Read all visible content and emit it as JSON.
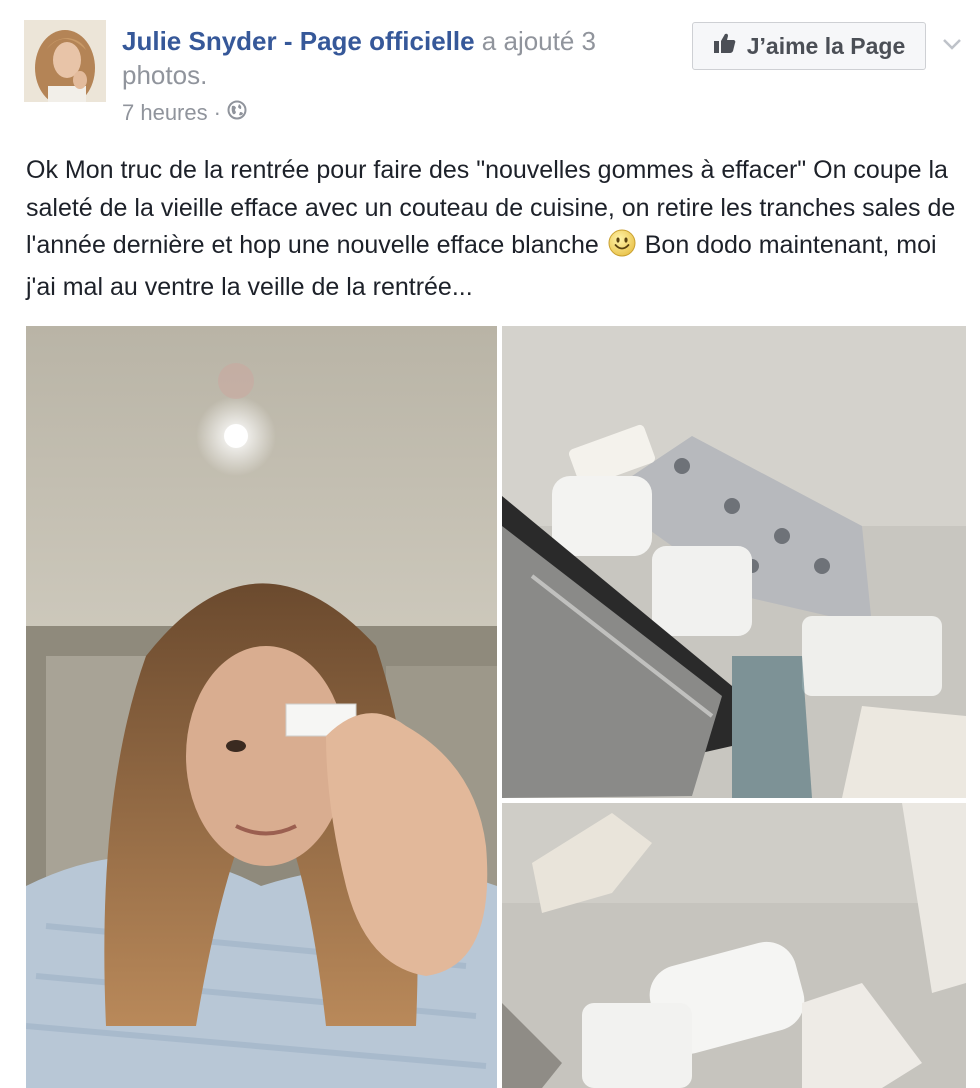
{
  "post": {
    "author": "Julie Snyder - Page officielle",
    "action": "a ajouté 3 photos.",
    "timestamp": "7 heures",
    "separator": "·",
    "privacy_icon": "globe-icon",
    "like_page_button": {
      "label": "J’aime la Page",
      "icon": "thumbs-up-icon"
    },
    "options_icon": "chevron-down-icon",
    "message_text": "Ok Mon truc de la rentrée pour faire des \"nouvelles gommes à effacer\" On coupe la saleté de la vieille efface avec un couteau de cuisine, on retire les tranches sales de l'année dernière et hop une nouvelle efface blanche",
    "message_emoji": "smiley-emoji",
    "message_text_2": " Bon dodo maintenant, moi j'ai mal au ventre la veille de la rentrée...",
    "photos": [
      {
        "subject": "selfie-holding-eraser"
      },
      {
        "subject": "knife-cutting-eraser"
      },
      {
        "subject": "eraser-pieces"
      }
    ]
  },
  "colors": {
    "link": "#365899",
    "secondary_text": "#90949c",
    "body_text": "#1d2129",
    "button_bg": "#f6f7f9",
    "button_border": "#ced0d4"
  }
}
